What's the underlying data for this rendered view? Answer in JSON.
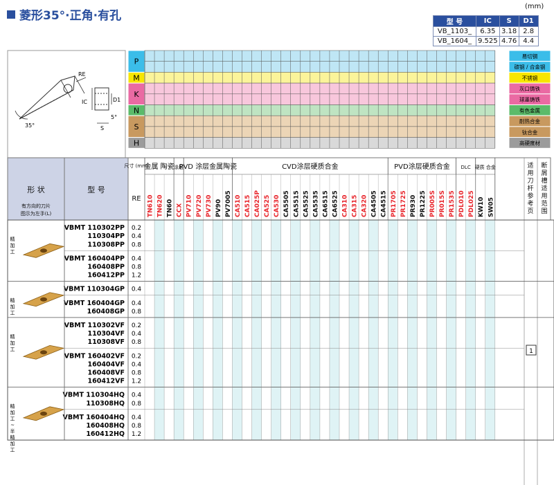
{
  "title": "菱形35°·正角·有孔",
  "unit": "(mm)",
  "dim_table": {
    "headers": [
      "型 号",
      "IC",
      "S",
      "D1"
    ],
    "rows": [
      [
        "VB_1103_",
        "6.35",
        "3.18",
        "2.8"
      ],
      [
        "VB_1604_",
        "9.525",
        "4.76",
        "4.4"
      ]
    ]
  },
  "diagram_labels": {
    "re": "RE",
    "ic": "IC",
    "d1": "D1",
    "s": "S",
    "a35": "35°",
    "a5": "5°"
  },
  "materials": [
    {
      "letter": "P",
      "color": "#3bbde9",
      "sub": [
        {
          "name": "易切钢",
          "bg": "#bfe6f5"
        },
        {
          "name": "碳钢 / 合金钢",
          "bg": "#bfe6f5"
        }
      ]
    },
    {
      "letter": "M",
      "color": "#f7e600",
      "sub": [
        {
          "name": "不锈钢",
          "bg": "#fbf49a"
        }
      ]
    },
    {
      "letter": "K",
      "color": "#ea6aa3",
      "sub": [
        {
          "name": "灰口铸铁",
          "bg": "#f8c7dc"
        },
        {
          "name": "球墨铸铁",
          "bg": "#f8c7dc"
        }
      ]
    },
    {
      "letter": "N",
      "color": "#5bbb6a",
      "sub": [
        {
          "name": "有色金属",
          "bg": "#bfe4c2"
        }
      ]
    },
    {
      "letter": "S",
      "color": "#c8995f",
      "sub": [
        {
          "name": "耐热合金",
          "bg": "#ecd5b6"
        },
        {
          "name": "钛合金",
          "bg": "#ecd5b6"
        }
      ]
    },
    {
      "letter": "H",
      "color": "#9b9b9b",
      "sub": [
        {
          "name": "高硬度材",
          "bg": "#d9d9d9"
        }
      ]
    }
  ],
  "header": {
    "shape": "形 状",
    "shape_note1": "有方向的刀片",
    "shape_note2": "图示为左手(L)",
    "model": "型 号",
    "size": "尺寸 (mm)",
    "re": "RE",
    "group_cermet": "金属 陶瓷",
    "group_cbn": "涂层",
    "group_pvd_cermet": "PVD 涂层金属陶瓷",
    "group_cvd": "CVD涂层硬质合金",
    "group_pvd": "PVD涂层硬质合金",
    "group_dlc": "DLC",
    "group_carbide": "硬质 合金",
    "group_holder": "适用刀杆参考页",
    "group_chip": "断屑槽适用范围"
  },
  "grades": [
    {
      "name": "TN610",
      "color": "#e8262c"
    },
    {
      "name": "TN620",
      "color": "#e8262c"
    },
    {
      "name": "TN60",
      "color": "#111111"
    },
    {
      "name": "CCX",
      "color": "#e8262c"
    },
    {
      "name": "PV710",
      "color": "#e8262c"
    },
    {
      "name": "PV720",
      "color": "#e8262c"
    },
    {
      "name": "PV730",
      "color": "#e8262c"
    },
    {
      "name": "PV90",
      "color": "#111111"
    },
    {
      "name": "PV7005",
      "color": "#111111"
    },
    {
      "name": "CA510",
      "color": "#e8262c"
    },
    {
      "name": "CA515",
      "color": "#e8262c"
    },
    {
      "name": "CA025P",
      "color": "#e8262c"
    },
    {
      "name": "CA525",
      "color": "#e8262c"
    },
    {
      "name": "CA530",
      "color": "#e8262c"
    },
    {
      "name": "CA5505",
      "color": "#111111"
    },
    {
      "name": "CA5515",
      "color": "#111111"
    },
    {
      "name": "CA5525",
      "color": "#111111"
    },
    {
      "name": "CA5535",
      "color": "#111111"
    },
    {
      "name": "CA6515",
      "color": "#111111"
    },
    {
      "name": "CA6525",
      "color": "#111111"
    },
    {
      "name": "CA310",
      "color": "#e8262c"
    },
    {
      "name": "CA315",
      "color": "#e8262c"
    },
    {
      "name": "CA320",
      "color": "#e8262c"
    },
    {
      "name": "CA4505",
      "color": "#111111"
    },
    {
      "name": "CA4515",
      "color": "#111111"
    },
    {
      "name": "PR1705",
      "color": "#e8262c"
    },
    {
      "name": "PR1725",
      "color": "#e8262c"
    },
    {
      "name": "PR930",
      "color": "#111111"
    },
    {
      "name": "PR1225",
      "color": "#111111"
    },
    {
      "name": "PR005S",
      "color": "#e8262c"
    },
    {
      "name": "PR015S",
      "color": "#e8262c"
    },
    {
      "name": "PR1535",
      "color": "#e8262c"
    },
    {
      "name": "PDL010",
      "color": "#e8262c"
    },
    {
      "name": "PDL025",
      "color": "#e8262c"
    },
    {
      "name": "KW10",
      "color": "#111111"
    },
    {
      "name": "SW05",
      "color": "#111111"
    }
  ],
  "groups": [
    {
      "label": "精加工",
      "rows": [
        {
          "model_prefix": "VBMT",
          "models": [
            "110302PP",
            "110304PP",
            "110308PP"
          ],
          "re": [
            "0.2",
            "0.4",
            "0.8"
          ]
        },
        {
          "model_prefix": "VBMT",
          "models": [
            "160404PP",
            "160408PP",
            "160412PP"
          ],
          "re": [
            "0.4",
            "0.8",
            "1.2"
          ]
        }
      ]
    },
    {
      "label": "精加工",
      "rows": [
        {
          "model_prefix": "VBMT",
          "models": [
            "110304GP"
          ],
          "re": [
            "0.4"
          ]
        },
        {
          "model_prefix": "VBMT",
          "models": [
            "160404GP",
            "160408GP"
          ],
          "re": [
            "0.4",
            "0.8"
          ]
        }
      ]
    },
    {
      "label": "精加工",
      "rows": [
        {
          "model_prefix": "VBMT",
          "models": [
            "110302VF",
            "110304VF",
            "110308VF"
          ],
          "re": [
            "0.2",
            "0.4",
            "0.8"
          ]
        },
        {
          "model_prefix": "VBMT",
          "models": [
            "160402VF",
            "160404VF",
            "160408VF",
            "160412VF"
          ],
          "re": [
            "0.2",
            "0.4",
            "0.8",
            "1.2"
          ]
        }
      ]
    },
    {
      "label": "精加工 ~ 半精加工",
      "rows": [
        {
          "model_prefix": "VBMT",
          "models": [
            "110304HQ",
            "110308HQ"
          ],
          "re": [
            "0.4",
            "0.8"
          ]
        },
        {
          "model_prefix": "VBMT",
          "models": [
            "160404HQ",
            "160408HQ",
            "160412HQ"
          ],
          "re": [
            "0.4",
            "0.8",
            "1.2"
          ]
        }
      ]
    }
  ],
  "holder_page": "1"
}
